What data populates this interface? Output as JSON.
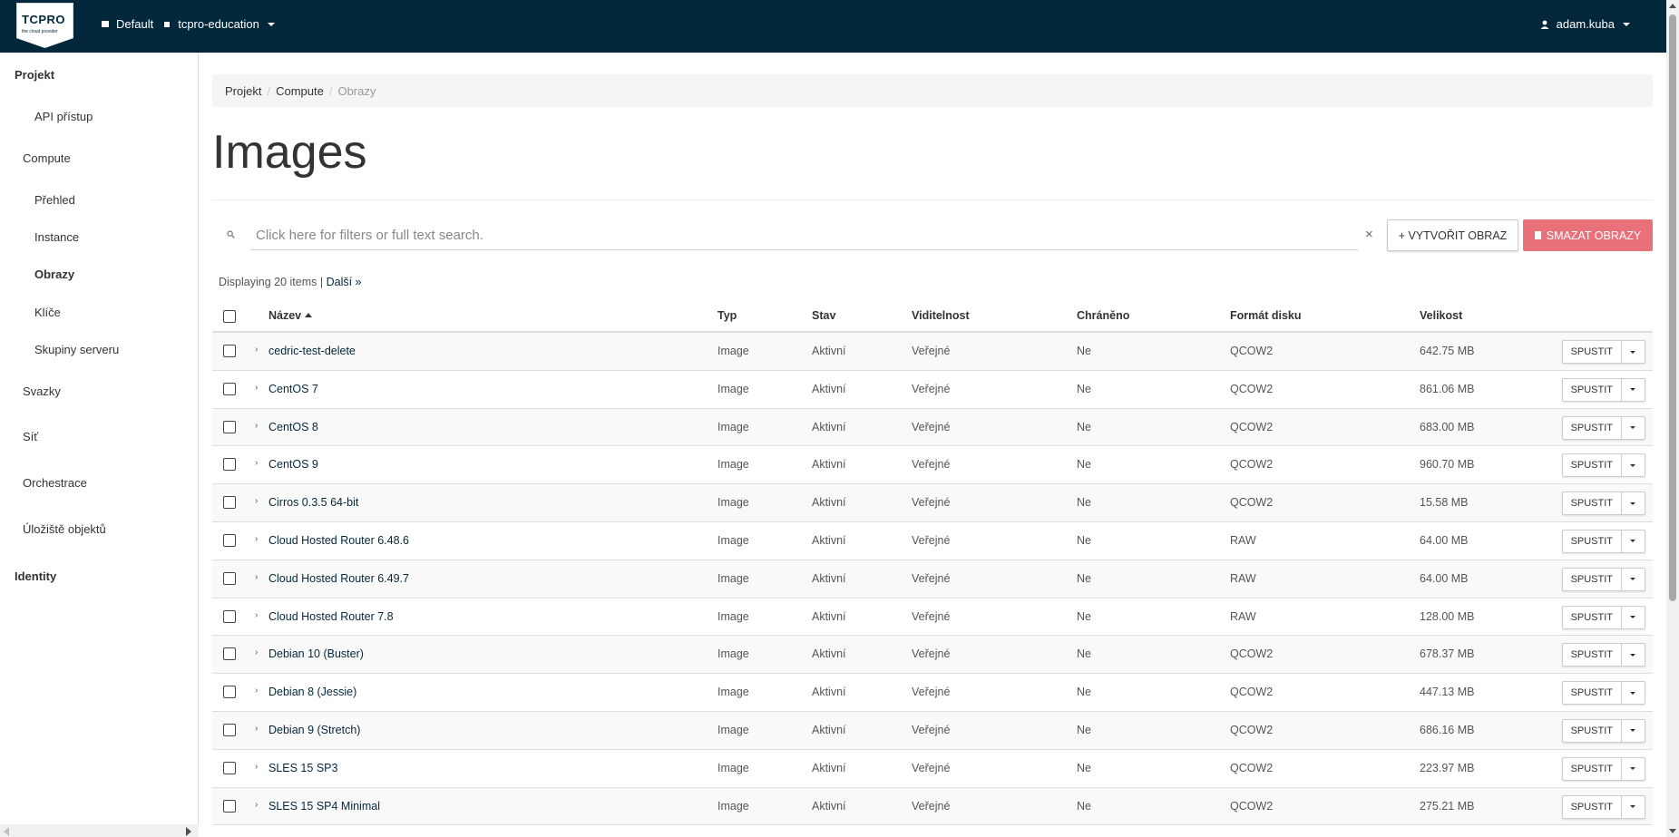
{
  "topbar": {
    "logo_text": "TCPRO",
    "logo_tagline": "the cloud provider",
    "domain": "Default",
    "project": "tcpro-education",
    "user": "adam.kuba"
  },
  "sidebar": {
    "section_project": "Projekt",
    "api_access": "API přístup",
    "compute": "Compute",
    "overview": "Přehled",
    "instances": "Instance",
    "images": "Obrazy",
    "keys": "Klíče",
    "server_groups": "Skupiny serveru",
    "volumes": "Svazky",
    "network": "Síť",
    "orchestration": "Orchestrace",
    "object_store": "Úložiště objektů",
    "section_identity": "Identity"
  },
  "breadcrumb": {
    "project": "Projekt",
    "compute": "Compute",
    "current": "Obrazy"
  },
  "page_title": "Images",
  "toolbar": {
    "search_placeholder": "Click here for filters or full text search.",
    "clear": "×",
    "create_label": "+ VYTVOŘIT OBRAZ",
    "delete_label": "SMAZAT OBRAZY"
  },
  "count": {
    "text": "Displaying 20 items |",
    "next": "Další »"
  },
  "table": {
    "headers": {
      "name": "Název",
      "type": "Typ",
      "status": "Stav",
      "visibility": "Viditelnost",
      "protected": "Chráněno",
      "format": "Formát disku",
      "size": "Velikost"
    },
    "launch_label": "SPUSTIT",
    "rows": [
      {
        "name": "cedric-test-delete",
        "type": "Image",
        "status": "Aktivní",
        "visibility": "Veřejné",
        "protected": "Ne",
        "format": "QCOW2",
        "size": "642.75 MB"
      },
      {
        "name": "CentOS 7",
        "type": "Image",
        "status": "Aktivní",
        "visibility": "Veřejné",
        "protected": "Ne",
        "format": "QCOW2",
        "size": "861.06 MB"
      },
      {
        "name": "CentOS 8",
        "type": "Image",
        "status": "Aktivní",
        "visibility": "Veřejné",
        "protected": "Ne",
        "format": "QCOW2",
        "size": "683.00 MB"
      },
      {
        "name": "CentOS 9",
        "type": "Image",
        "status": "Aktivní",
        "visibility": "Veřejné",
        "protected": "Ne",
        "format": "QCOW2",
        "size": "960.70 MB"
      },
      {
        "name": "Cirros 0.3.5 64-bit",
        "type": "Image",
        "status": "Aktivní",
        "visibility": "Veřejné",
        "protected": "Ne",
        "format": "QCOW2",
        "size": "15.58 MB"
      },
      {
        "name": "Cloud Hosted Router 6.48.6",
        "type": "Image",
        "status": "Aktivní",
        "visibility": "Veřejné",
        "protected": "Ne",
        "format": "RAW",
        "size": "64.00 MB"
      },
      {
        "name": "Cloud Hosted Router 6.49.7",
        "type": "Image",
        "status": "Aktivní",
        "visibility": "Veřejné",
        "protected": "Ne",
        "format": "RAW",
        "size": "64.00 MB"
      },
      {
        "name": "Cloud Hosted Router 7.8",
        "type": "Image",
        "status": "Aktivní",
        "visibility": "Veřejné",
        "protected": "Ne",
        "format": "RAW",
        "size": "128.00 MB"
      },
      {
        "name": "Debian 10 (Buster)",
        "type": "Image",
        "status": "Aktivní",
        "visibility": "Veřejné",
        "protected": "Ne",
        "format": "QCOW2",
        "size": "678.37 MB"
      },
      {
        "name": "Debian 8 (Jessie)",
        "type": "Image",
        "status": "Aktivní",
        "visibility": "Veřejné",
        "protected": "Ne",
        "format": "QCOW2",
        "size": "447.13 MB"
      },
      {
        "name": "Debian 9 (Stretch)",
        "type": "Image",
        "status": "Aktivní",
        "visibility": "Veřejné",
        "protected": "Ne",
        "format": "QCOW2",
        "size": "686.16 MB"
      },
      {
        "name": "SLES 15 SP3",
        "type": "Image",
        "status": "Aktivní",
        "visibility": "Veřejné",
        "protected": "Ne",
        "format": "QCOW2",
        "size": "223.97 MB"
      },
      {
        "name": "SLES 15 SP4 Minimal",
        "type": "Image",
        "status": "Aktivní",
        "visibility": "Veřejné",
        "protected": "Ne",
        "format": "QCOW2",
        "size": "275.21 MB"
      }
    ]
  }
}
